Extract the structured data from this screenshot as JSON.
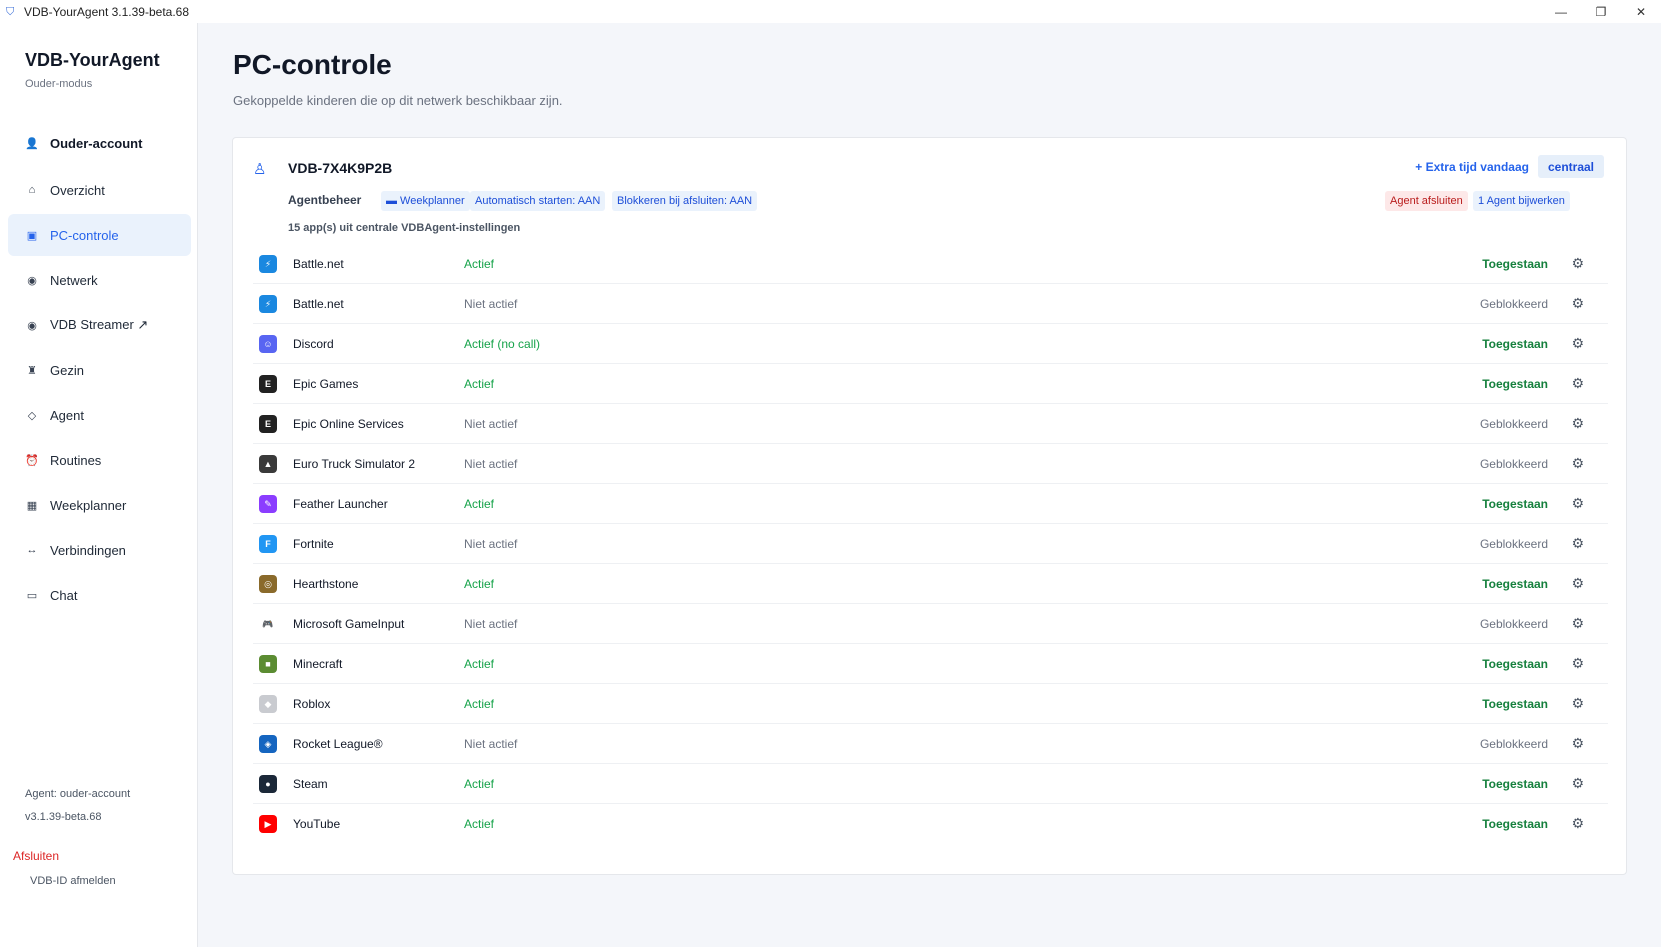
{
  "window": {
    "title": "VDB-YourAgent 3.1.39-beta.68",
    "minimize": "—",
    "restore": "❐",
    "close": "✕"
  },
  "sidebar": {
    "brand": "VDB-YourAgent",
    "mode": "Ouder-modus",
    "items": [
      {
        "icon": "person-icon",
        "glyph": "👤",
        "label": "Ouder-account"
      },
      {
        "icon": "home-icon",
        "glyph": "⌂",
        "label": "Overzicht"
      },
      {
        "icon": "monitor-icon",
        "glyph": "▣",
        "label": "PC-controle"
      },
      {
        "icon": "network-icon",
        "glyph": "◉",
        "label": "Netwerk"
      },
      {
        "icon": "record-icon",
        "glyph": "◉",
        "label": "VDB Streamer ↗"
      },
      {
        "icon": "family-icon",
        "glyph": "♜",
        "label": "Gezin"
      },
      {
        "icon": "diamond-icon",
        "glyph": "◇",
        "label": "Agent"
      },
      {
        "icon": "alarm-icon",
        "glyph": "⏰",
        "label": "Routines"
      },
      {
        "icon": "calendar-icon",
        "glyph": "▦",
        "label": "Weekplanner"
      },
      {
        "icon": "link-icon",
        "glyph": "↔",
        "label": "Verbindingen"
      },
      {
        "icon": "chat-icon",
        "glyph": "▭",
        "label": "Chat"
      }
    ],
    "agent_label": "Agent: ouder-account",
    "version": "v3.1.39-beta.68",
    "quit": "Afsluiten",
    "logout": "VDB-ID afmelden"
  },
  "main": {
    "title": "PC-controle",
    "subtitle": "Gekoppelde kinderen die op dit netwerk beschikbaar zijn."
  },
  "device": {
    "icon": "child-icon",
    "name": "VDB-7X4K9P2B",
    "extra_time": "+ Extra tijd vandaag",
    "central": "centraal",
    "agent_mgmt": "Agentbeheer",
    "chips": {
      "weekplanner": "▬ Weekplanner",
      "autostart": "Automatisch starten: AAN",
      "block_on_close": "Blokkeren bij afsluiten: AAN",
      "agent_quit": "Agent afsluiten",
      "agent_update": "1 Agent bijwerken"
    },
    "apps_count": "15 app(s) uit centrale VDBAgent-instellingen"
  },
  "apps": [
    {
      "name": "Battle.net",
      "status": "Actief",
      "active": true,
      "perm": "Toegestaan",
      "allowed": true,
      "icon": "battlenet-icon",
      "color": "#1a88e0",
      "glyph": "⚡"
    },
    {
      "name": "Battle.net",
      "status": "Niet actief",
      "active": false,
      "perm": "Geblokkeerd",
      "allowed": false,
      "icon": "battlenet-icon",
      "color": "#1a88e0",
      "glyph": "⚡"
    },
    {
      "name": "Discord",
      "status": "Actief (no call)",
      "active": true,
      "perm": "Toegestaan",
      "allowed": true,
      "icon": "discord-icon",
      "color": "#5865f2",
      "glyph": "☺"
    },
    {
      "name": "Epic Games",
      "status": "Actief",
      "active": true,
      "perm": "Toegestaan",
      "allowed": true,
      "icon": "epic-games-icon",
      "color": "#222222",
      "glyph": "E"
    },
    {
      "name": "Epic Online Services",
      "status": "Niet actief",
      "active": false,
      "perm": "Geblokkeerd",
      "allowed": false,
      "icon": "epic-games-icon",
      "color": "#222222",
      "glyph": "E"
    },
    {
      "name": "Euro Truck Simulator 2",
      "status": "Niet actief",
      "active": false,
      "perm": "Geblokkeerd",
      "allowed": false,
      "icon": "truck-icon",
      "color": "#3a3a3a",
      "glyph": "▲"
    },
    {
      "name": "Feather Launcher",
      "status": "Actief",
      "active": true,
      "perm": "Toegestaan",
      "allowed": true,
      "icon": "feather-icon",
      "color": "#8b3dff",
      "glyph": "✎"
    },
    {
      "name": "Fortnite",
      "status": "Niet actief",
      "active": false,
      "perm": "Geblokkeerd",
      "allowed": false,
      "icon": "fortnite-icon",
      "color": "#2196f3",
      "glyph": "F"
    },
    {
      "name": "Hearthstone",
      "status": "Actief",
      "active": true,
      "perm": "Toegestaan",
      "allowed": true,
      "icon": "hearthstone-icon",
      "color": "#8a6a2b",
      "glyph": "◎"
    },
    {
      "name": "Microsoft GameInput",
      "status": "Niet actief",
      "active": false,
      "perm": "Geblokkeerd",
      "allowed": false,
      "icon": "gamepad-icon",
      "color": "#ffffff",
      "glyph": "🎮"
    },
    {
      "name": "Minecraft",
      "status": "Actief",
      "active": true,
      "perm": "Toegestaan",
      "allowed": true,
      "icon": "minecraft-icon",
      "color": "#5b8c32",
      "glyph": "■"
    },
    {
      "name": "Roblox",
      "status": "Actief",
      "active": true,
      "perm": "Toegestaan",
      "allowed": true,
      "icon": "roblox-icon",
      "color": "#c9cbd0",
      "glyph": "◆"
    },
    {
      "name": "Rocket League®",
      "status": "Niet actief",
      "active": false,
      "perm": "Geblokkeerd",
      "allowed": false,
      "icon": "rocket-league-icon",
      "color": "#1565c0",
      "glyph": "◈"
    },
    {
      "name": "Steam",
      "status": "Actief",
      "active": true,
      "perm": "Toegestaan",
      "allowed": true,
      "icon": "steam-icon",
      "color": "#1b2838",
      "glyph": "●"
    },
    {
      "name": "YouTube",
      "status": "Actief",
      "active": true,
      "perm": "Toegestaan",
      "allowed": true,
      "icon": "youtube-icon",
      "color": "#ff0000",
      "glyph": "▶"
    }
  ],
  "gear_glyph": "⚙"
}
